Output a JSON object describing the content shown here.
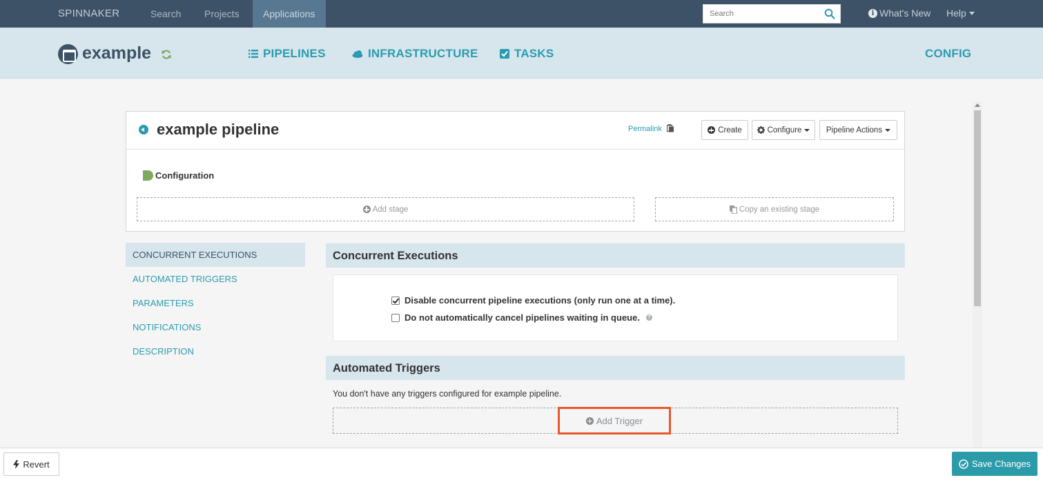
{
  "topnav": {
    "brand": "SPINNAKER",
    "links": [
      "Search",
      "Projects",
      "Applications"
    ],
    "search_placeholder": "Search",
    "whats_new": "What's New",
    "help": "Help"
  },
  "app": {
    "name": "example",
    "tabs": {
      "pipelines": "PIPELINES",
      "infrastructure": "INFRASTRUCTURE",
      "tasks": "TASKS",
      "config": "CONFIG"
    }
  },
  "pipeline": {
    "title": "example pipeline",
    "permalink": "Permalink",
    "buttons": {
      "create": "Create",
      "configure": "Configure",
      "actions": "Pipeline Actions"
    },
    "stage_label": "Configuration",
    "add_stage": "Add stage",
    "copy_stage": "Copy an existing stage"
  },
  "sidenav": [
    "CONCURRENT EXECUTIONS",
    "AUTOMATED TRIGGERS",
    "PARAMETERS",
    "NOTIFICATIONS",
    "DESCRIPTION"
  ],
  "concurrent": {
    "heading": "Concurrent Executions",
    "opt1": "Disable concurrent pipeline executions (only run one at a time).",
    "opt1_checked": true,
    "opt2": "Do not automatically cancel pipelines waiting in queue.",
    "opt2_checked": false
  },
  "triggers": {
    "heading": "Automated Triggers",
    "empty_msg": "You don't have any triggers configured for example pipeline.",
    "add_trigger": "Add Trigger"
  },
  "footer": {
    "revert": "Revert",
    "save": "Save Changes"
  },
  "colors": {
    "accent": "#2b9bb0",
    "nav_bg": "#3d5266",
    "header_bg": "#d7e6ec",
    "highlight": "#e8572d",
    "save": "#2c9ba9"
  }
}
